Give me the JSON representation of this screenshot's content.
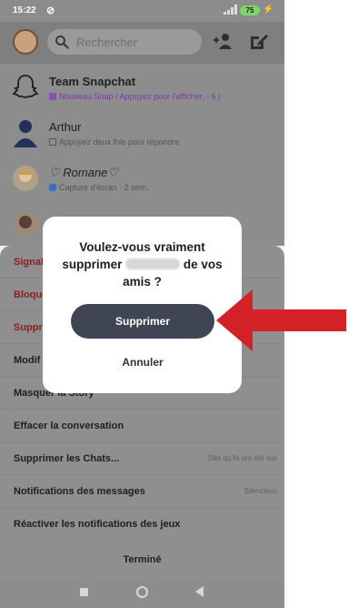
{
  "status_bar": {
    "time": "15:22",
    "battery": "75"
  },
  "header": {
    "search_placeholder": "Rechercher"
  },
  "chats": [
    {
      "name": "Team Snapchat",
      "subtitle": "Nouveau Snap ! Appuyez pour l'afficher. · 6 j",
      "indicator_color": "#8a4fb8"
    },
    {
      "name": "Arthur",
      "subtitle": "Appuyez deux fois pour répondre",
      "indicator_color": "#555555"
    },
    {
      "name": "♡ Romane♡",
      "subtitle": "Capture d'écran · 2 sem.",
      "indicator_color": "#3a6fc0"
    }
  ],
  "sheet": {
    "items": [
      {
        "label": "Signal",
        "value": "",
        "danger": true
      },
      {
        "label": "Bloque",
        "value": "",
        "danger": true
      },
      {
        "label": "Suppr",
        "value": "",
        "danger": true
      },
      {
        "label": "Modif",
        "value": "",
        "danger": false
      },
      {
        "label": "Masquer la Story",
        "value": "",
        "danger": false
      },
      {
        "label": "Effacer la conversation",
        "value": "",
        "danger": false
      },
      {
        "label": "Supprimer les Chats...",
        "value": "Dès qu'ils ont été vus",
        "danger": false
      },
      {
        "label": "Notifications des messages",
        "value": "Silencieux",
        "danger": false
      },
      {
        "label": "Réactiver les notifications des jeux",
        "value": "",
        "danger": false
      }
    ],
    "done_label": "Terminé"
  },
  "dialog": {
    "line1": "Voulez-vous vraiment",
    "line2_prefix": "supprimer",
    "line2_suffix": "de vos",
    "line3": "amis ?",
    "confirm_label": "Supprimer",
    "cancel_label": "Annuler"
  },
  "colors": {
    "primary_button": "#3f4552",
    "arrow": "#d42127",
    "danger_text": "#8a1f1f"
  }
}
